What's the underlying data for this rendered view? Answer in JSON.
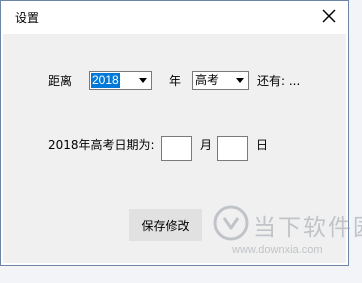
{
  "window": {
    "title": "设置",
    "close_icon": "close-icon"
  },
  "form": {
    "distance_label": "距离",
    "year_select": {
      "value": "2018"
    },
    "year_label": "年",
    "exam_select": {
      "value": "高考"
    },
    "remaining_label": "还有: ..."
  },
  "date_row": {
    "label": "2018年高考日期为:",
    "month_field": {
      "value": ""
    },
    "month_label": "月",
    "day_field": {
      "value": ""
    },
    "day_label": "日"
  },
  "actions": {
    "save_label": "保存修改"
  },
  "watermark": {
    "main_text": "当下软件园",
    "url_text": "www.downxia.com",
    "logo_icon": "downxia-logo-icon"
  },
  "colors": {
    "accent": "#0078d7",
    "window_border": "#6c86a7",
    "client_bg": "#f0f0f0",
    "button_bg": "#e1e1e1",
    "watermark": "#9aa0a6"
  }
}
